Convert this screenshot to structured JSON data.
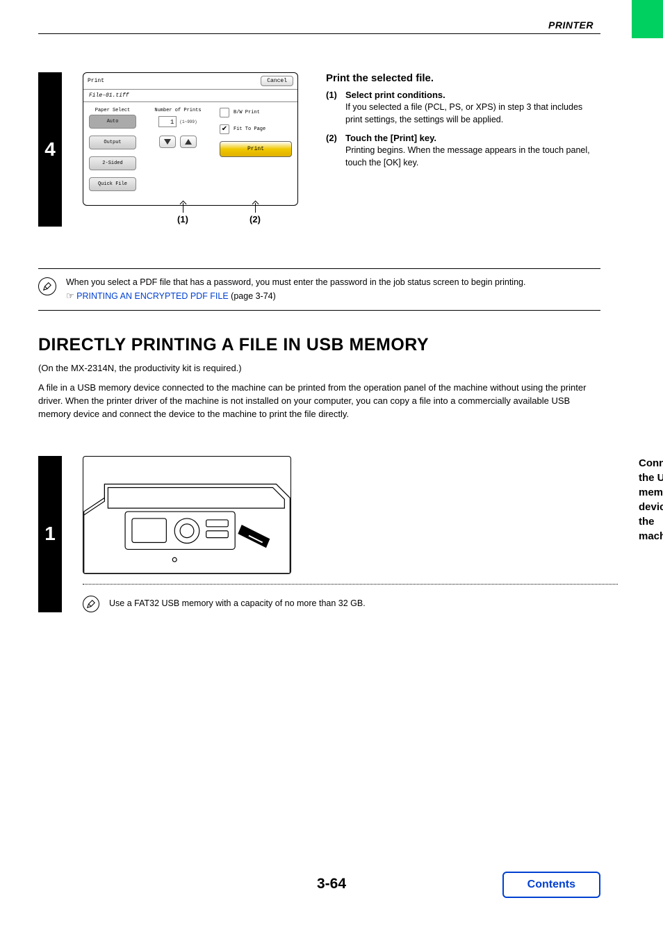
{
  "header": {
    "section": "PRINTER"
  },
  "step4": {
    "number": "4",
    "dialog": {
      "title": "Print",
      "cancel": "Cancel",
      "filename": "File-01.tiff",
      "paperSelectLbl": "Paper Select",
      "paperSelectVal": "Auto",
      "outputBtn": "Output",
      "twosidedBtn": "2-Sided",
      "quickFileBtn": "Quick File",
      "numPrintsLbl": "Number of Prints",
      "numPrintsVal": "1",
      "numPrintsRange": "(1~999)",
      "bwPrint": "B/W Print",
      "fitToPage": "Fit To Page",
      "printBtn": "Print"
    },
    "callout1": "(1)",
    "callout2": "(2)",
    "title": "Print the selected file.",
    "items": [
      {
        "num": "(1)",
        "label": "Select print conditions.",
        "desc": "If you selected a file (PCL, PS, or XPS) in step 3 that includes print settings, the settings will be applied."
      },
      {
        "num": "(2)",
        "label": "Touch the [Print] key.",
        "desc": "Printing begins. When the message appears in the touch panel, touch the [OK] key."
      }
    ]
  },
  "note": {
    "text": "When you select a PDF file that has a password, you must enter the password in the job status screen to begin printing.",
    "linkPrefix": "☞",
    "linkText": "PRINTING AN ENCRYPTED PDF FILE",
    "linkSuffix": " (page 3-74)"
  },
  "h1": "DIRECTLY PRINTING A FILE IN USB MEMORY",
  "p1": "(On the MX-2314N, the productivity kit is required.)",
  "p2": "A file in a USB memory device connected to the machine can be printed from the operation panel of the machine without using the printer driver. When the printer driver of the machine is not installed on your computer, you can copy a file into a commercially available USB memory device and connect the device to the machine to print the file directly.",
  "step1": {
    "number": "1",
    "title": "Connect the USB memory device to the machine.",
    "subnote": "Use a FAT32 USB memory with a capacity of no more than 32 GB."
  },
  "footer": {
    "page": "3-64",
    "contents": "Contents"
  }
}
